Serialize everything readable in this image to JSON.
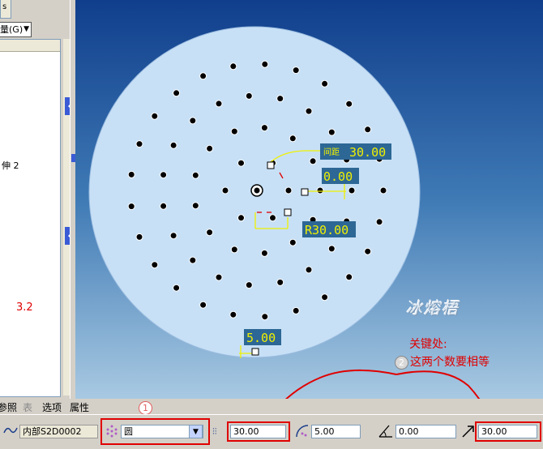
{
  "left_panel": {
    "tab_fragment": "s",
    "filter_dropdown": "量(G)",
    "tree_item_label": "伸 2",
    "side_note": "3.2"
  },
  "canvas": {
    "dimensions": {
      "spacing_label": "间距",
      "spacing_value": "30.00",
      "angle_value": "0.00",
      "radius_value": "R30.00",
      "edge_value": "5.00"
    },
    "watermark": "冰熔梧",
    "note_line_1": "关键处:",
    "note_line_2": "这两个数要相等",
    "step_2_badge": "2"
  },
  "dashboard_tabs": {
    "items": [
      "参照",
      "表",
      "选项",
      "属性"
    ],
    "step_1_badge": "1"
  },
  "toolbar": {
    "sketch_name": "内部S2D0002",
    "pattern_type": "圆",
    "spacing": "30.00",
    "edge_distance": "5.00",
    "rotation": "0.00",
    "radius_step": "30.00"
  },
  "colors": {
    "disk": "#c7e0f6",
    "dim_yellow": "#f0f000",
    "dim_box": "#2d6795",
    "annotation_red": "#e00000"
  }
}
